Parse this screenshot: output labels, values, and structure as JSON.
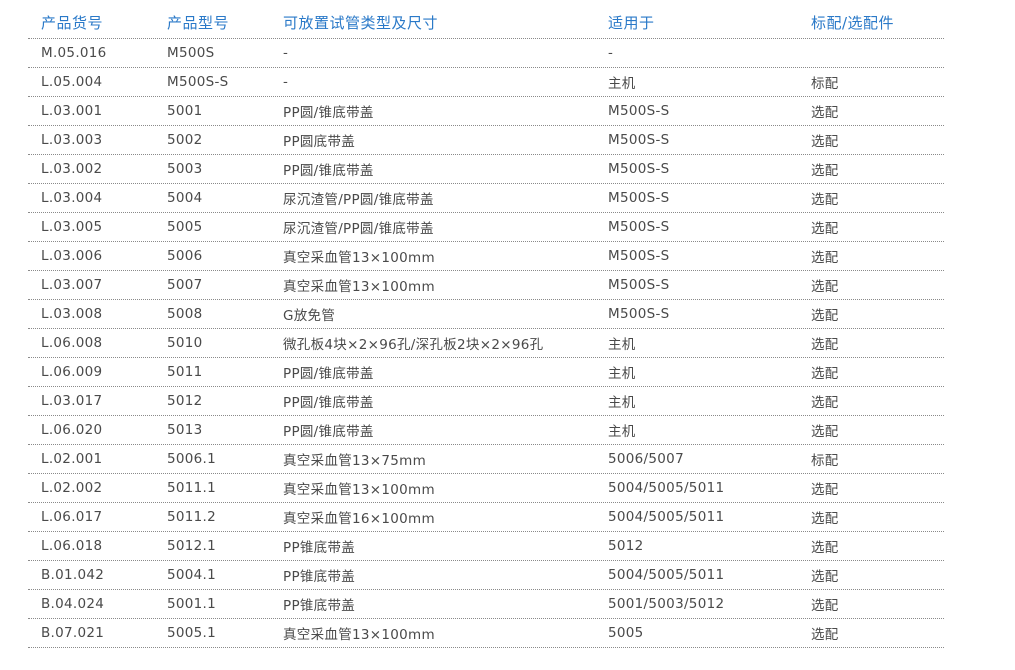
{
  "table": {
    "headers": [
      "产品货号",
      "产品型号",
      "可放置试管类型及尺寸",
      "适用于",
      "标配/选配件"
    ],
    "rows": [
      [
        "M.05.016",
        "M500S",
        "-",
        "-",
        ""
      ],
      [
        "L.05.004",
        "M500S-S",
        "-",
        "主机",
        "标配"
      ],
      [
        "L.03.001",
        "5001",
        "PP圆/锥底带盖",
        "M500S-S",
        "选配"
      ],
      [
        "L.03.003",
        "5002",
        "PP圆底带盖",
        "M500S-S",
        "选配"
      ],
      [
        "L.03.002",
        "5003",
        "PP圆/锥底带盖",
        "M500S-S",
        "选配"
      ],
      [
        "L.03.004",
        "5004",
        "尿沉渣管/PP圆/锥底带盖",
        "M500S-S",
        "选配"
      ],
      [
        "L.03.005",
        "5005",
        "尿沉渣管/PP圆/锥底带盖",
        "M500S-S",
        "选配"
      ],
      [
        "L.03.006",
        "5006",
        "真空采血管13×100mm",
        "M500S-S",
        "选配"
      ],
      [
        "L.03.007",
        "5007",
        "真空采血管13×100mm",
        "M500S-S",
        "选配"
      ],
      [
        "L.03.008",
        "5008",
        "G放免管",
        "M500S-S",
        "选配"
      ],
      [
        "L.06.008",
        "5010",
        "微孔板4块×2×96孔/深孔板2块×2×96孔",
        "主机",
        "选配"
      ],
      [
        "L.06.009",
        "5011",
        "PP圆/锥底带盖",
        "主机",
        "选配"
      ],
      [
        "L.03.017",
        "5012",
        "PP圆/锥底带盖",
        "主机",
        "选配"
      ],
      [
        "L.06.020",
        "5013",
        "PP圆/锥底带盖",
        "主机",
        "选配"
      ],
      [
        "L.02.001",
        "5006.1",
        "真空采血管13×75mm",
        "5006/5007",
        "标配"
      ],
      [
        "L.02.002",
        "5011.1",
        "真空采血管13×100mm",
        "5004/5005/5011",
        "选配"
      ],
      [
        "L.06.017",
        "5011.2",
        "真空采血管16×100mm",
        "5004/5005/5011",
        "选配"
      ],
      [
        "L.06.018",
        "5012.1",
        "PP锥底带盖",
        "5012",
        "选配"
      ],
      [
        "B.01.042",
        "5004.1",
        "PP锥底带盖",
        "5004/5005/5011",
        "选配"
      ],
      [
        "B.04.024",
        "5001.1",
        "PP锥底带盖",
        "5001/5003/5012",
        "选配"
      ],
      [
        "B.07.021",
        "5005.1",
        "真空采血管13×100mm",
        "5005",
        "选配"
      ]
    ]
  }
}
